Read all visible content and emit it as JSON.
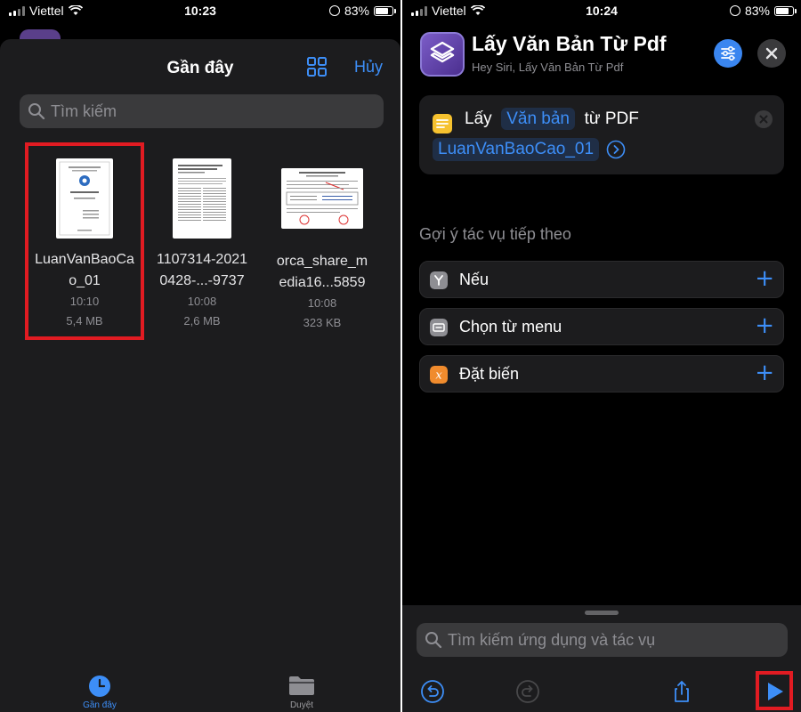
{
  "left": {
    "status": {
      "carrier": "Viettel",
      "time": "10:23",
      "battery": "83%"
    },
    "sheet": {
      "title": "Gần đây",
      "cancel_label": "Hủy",
      "search_placeholder": "Tìm kiếm"
    },
    "files": [
      {
        "name_line1": "LuanVanBaoCa",
        "name_line2": "o_01",
        "time": "10:10",
        "size": "5,4 MB"
      },
      {
        "name_line1": "1107314-2021",
        "name_line2": "0428-...-9737",
        "time": "10:08",
        "size": "2,6 MB"
      },
      {
        "name_line1": "orca_share_m",
        "name_line2": "edia16...5859",
        "time": "10:08",
        "size": "323 KB"
      }
    ],
    "tabs": {
      "recent": "Gần đây",
      "browse": "Duyệt"
    },
    "colors": {
      "accent": "#3d8ef7",
      "highlight": "#e11b22"
    }
  },
  "right": {
    "status": {
      "carrier": "Viettel",
      "time": "10:24",
      "battery": "83%"
    },
    "shortcut": {
      "title": "Lấy Văn Bản Từ Pdf",
      "subtitle": "Hey Siri, Lấy Văn Bản Từ Pdf"
    },
    "action": {
      "verb": "Lấy",
      "token": "Văn bản",
      "from_text": "từ PDF",
      "source_token": "LuanVanBaoCao_01"
    },
    "suggestions_header": "Gợi ý tác vụ tiếp theo",
    "suggestions": [
      {
        "label": "Nếu",
        "icon": "branch-icon"
      },
      {
        "label": "Chọn từ menu",
        "icon": "menu-icon"
      },
      {
        "label": "Đặt biến",
        "icon": "variable-icon"
      }
    ],
    "bottom_search_placeholder": "Tìm kiếm ứng dụng và tác vụ"
  }
}
